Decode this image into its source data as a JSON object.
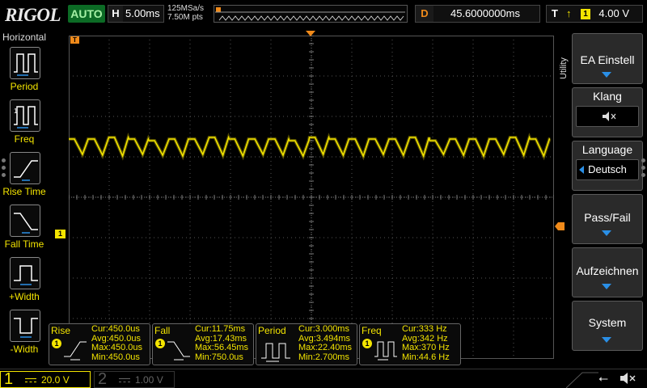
{
  "header": {
    "logo": "RIGOL",
    "run_state": "AUTO",
    "timebase_label": "H",
    "timebase_value": "5.00ms",
    "sample_rate": "125MSa/s",
    "memory_depth": "7.50M pts",
    "delay_label": "D",
    "delay_value": "45.6000000ms",
    "trigger_label": "T",
    "trigger_edge": "rising-edge-icon",
    "trigger_source": "1",
    "trigger_level": "4.00 V"
  },
  "left_menu": {
    "title": "Horizontal",
    "items": [
      {
        "label": "Period",
        "icon": "period-icon"
      },
      {
        "label": "Freq",
        "icon": "freq-icon"
      },
      {
        "label": "Rise Time",
        "icon": "rise-time-icon"
      },
      {
        "label": "Fall Time",
        "icon": "fall-time-icon"
      },
      {
        "label": "+Width",
        "icon": "positive-width-icon"
      },
      {
        "label": "-Width",
        "icon": "negative-width-icon"
      }
    ]
  },
  "right_menu": {
    "tab_label": "Utility",
    "items": [
      {
        "label": "EA Einstell"
      },
      {
        "label": "Klang",
        "value_icon": "speaker-muted-icon"
      },
      {
        "label": "Language",
        "value": "Deutsch"
      },
      {
        "label": "Pass/Fail"
      },
      {
        "label": "Aufzeichnen"
      },
      {
        "label": "System"
      }
    ]
  },
  "markers": {
    "channel_marker": "1",
    "trigger_top_marker": "T"
  },
  "measurements": [
    {
      "name": "Rise",
      "channel": "1",
      "cur": "Cur:450.0us",
      "avg": "Avg:450.0us",
      "max": "Max:450.0us",
      "min": "Min:450.0us"
    },
    {
      "name": "Fall",
      "channel": "1",
      "cur": "Cur:11.75ms",
      "avg": "Avg:17.43ms",
      "max": "Max:56.45ms",
      "min": "Min:750.0us"
    },
    {
      "name": "Period",
      "channel": "1",
      "cur": "Cur:3.000ms",
      "avg": "Avg:3.494ms",
      "max": "Max:22.40ms",
      "min": "Min:2.700ms"
    },
    {
      "name": "Freq",
      "channel": "1",
      "cur": "Cur:333 Hz",
      "avg": "Avg:342 Hz",
      "max": "Max:370 Hz",
      "min": "Min:44.6 Hz"
    }
  ],
  "channels": [
    {
      "number": "1",
      "scale": "20.0 V",
      "active": true,
      "color": "#f3e400"
    },
    {
      "number": "2",
      "scale": "1.00 V",
      "active": false,
      "color": "#555555"
    }
  ],
  "colors": {
    "ch1": "#f3e400",
    "trigger": "#f08a1a",
    "accent": "#2a8fe6",
    "run": "#0c6b25"
  }
}
